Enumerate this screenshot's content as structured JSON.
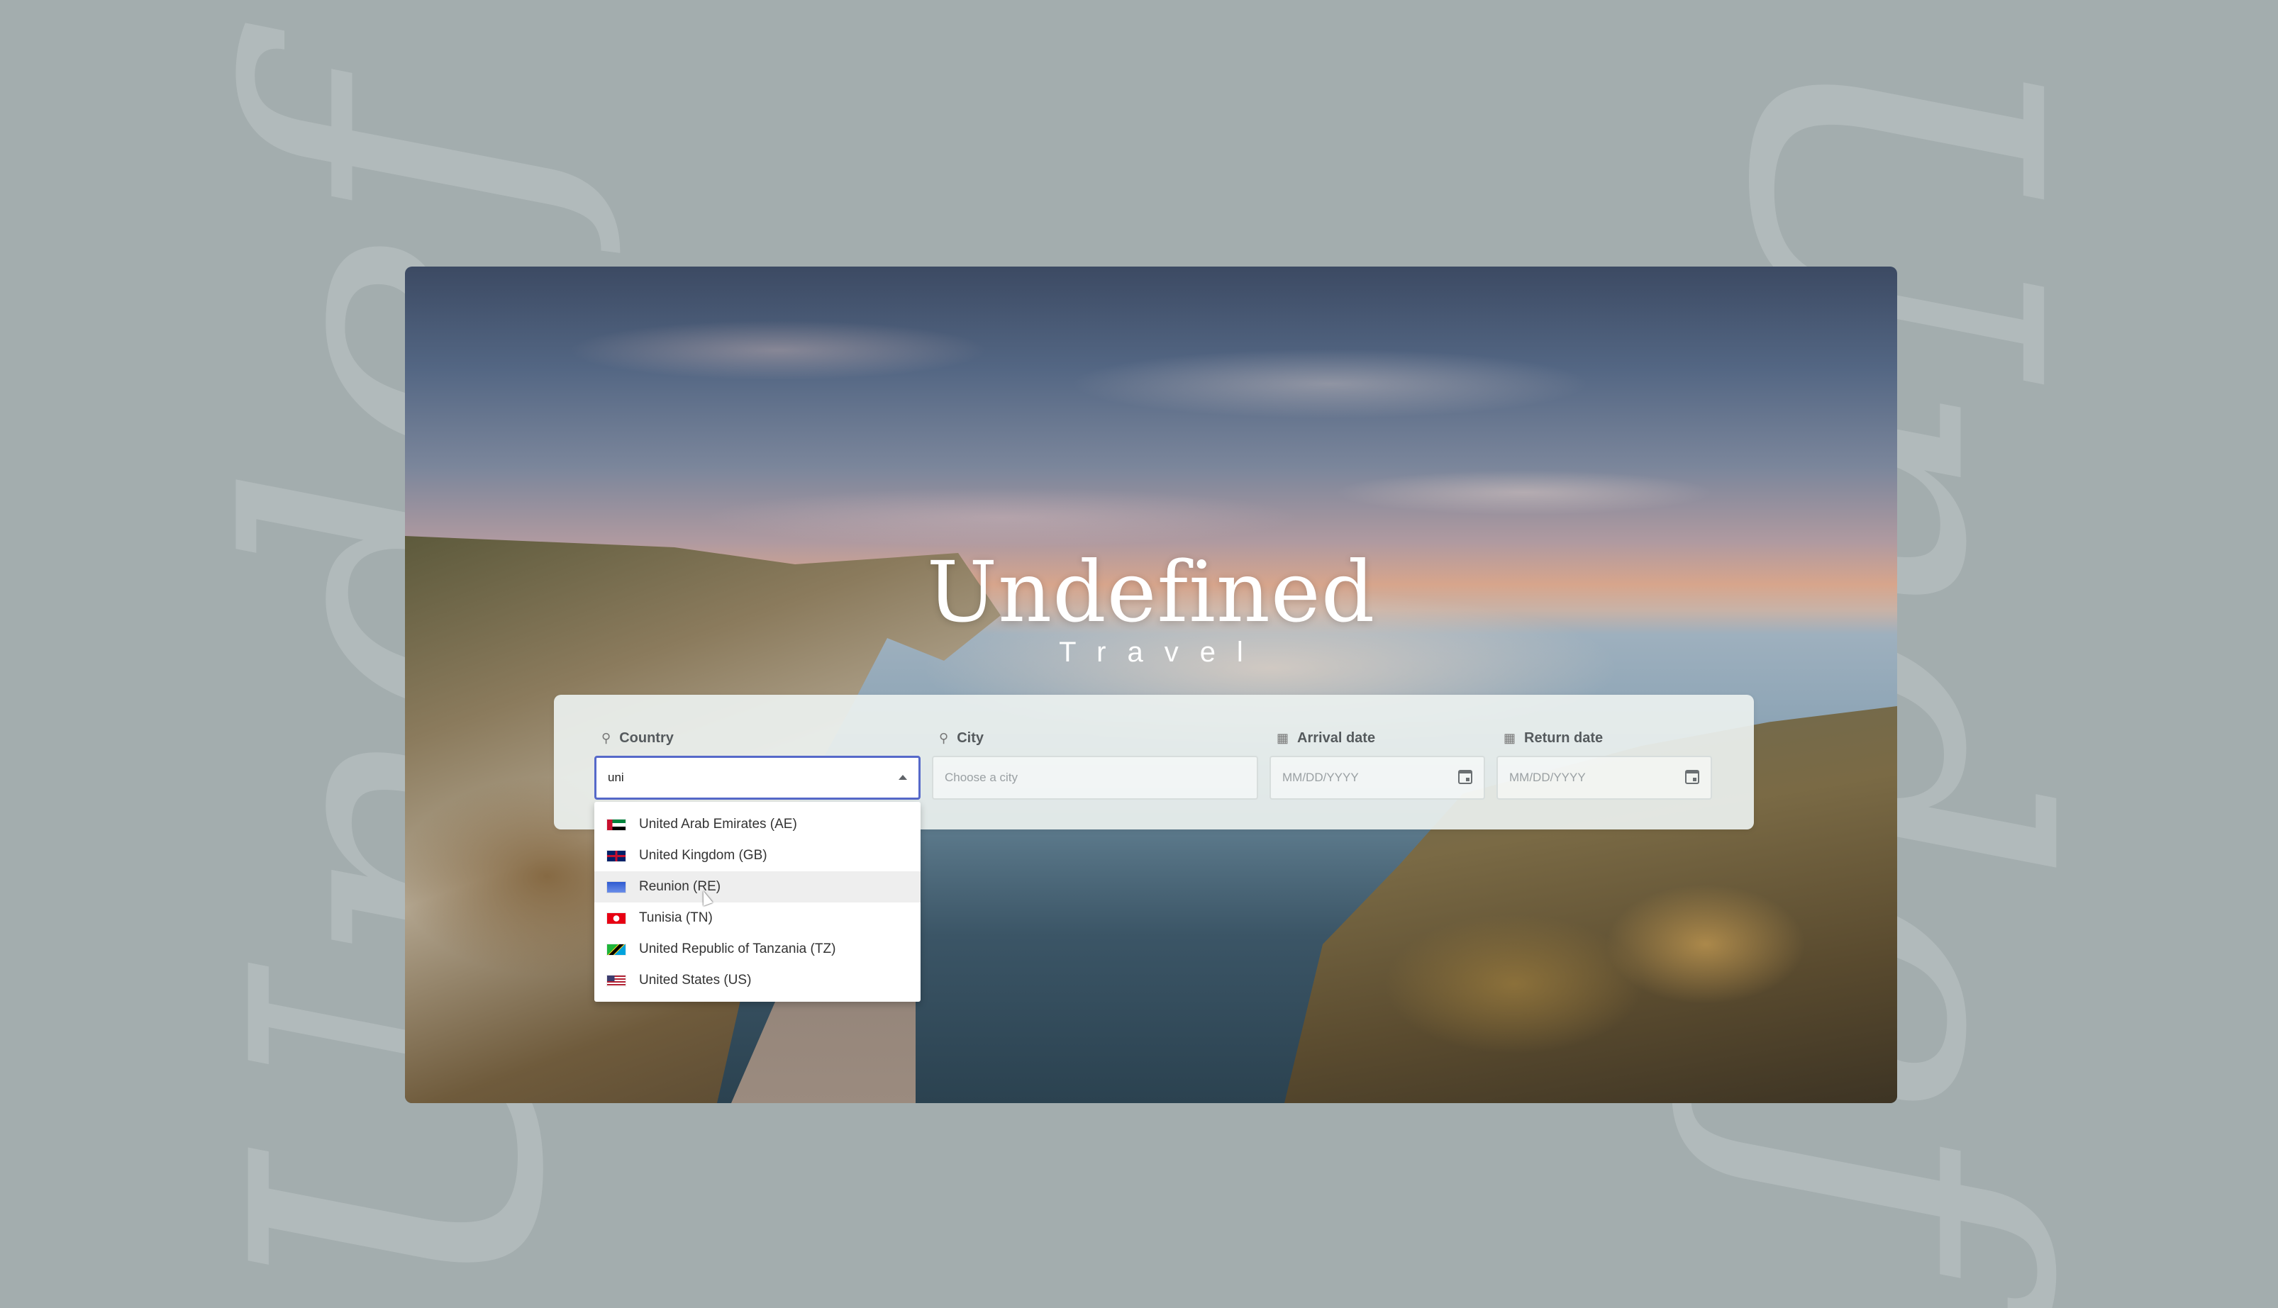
{
  "brand": {
    "title": "Undefined",
    "subtitle": "Travel"
  },
  "search": {
    "country": {
      "label": "Country",
      "icon": "map-pin-icon",
      "value": "uni"
    },
    "city": {
      "label": "City",
      "icon": "map-pin-icon",
      "placeholder": "Choose a city"
    },
    "arrival": {
      "label": "Arrival date",
      "icon": "calendar-icon",
      "placeholder": "MM/DD/YYYY"
    },
    "return": {
      "label": "Return date",
      "icon": "calendar-icon",
      "placeholder": "MM/DD/YYYY"
    }
  },
  "dropdown": {
    "options": [
      {
        "label": "United Arab Emirates (AE)",
        "flag": "ae"
      },
      {
        "label": "United Kingdom (GB)",
        "flag": "gb"
      },
      {
        "label": "Reunion (RE)",
        "flag": "re",
        "hovered": true
      },
      {
        "label": "Tunisia (TN)",
        "flag": "tn"
      },
      {
        "label": "United Republic of Tanzania (TZ)",
        "flag": "tz"
      },
      {
        "label": "United States (US)",
        "flag": "us"
      }
    ]
  },
  "colors": {
    "background": "#a3adae",
    "focus_border": "#5669c9",
    "panel": "#ecf1ef"
  }
}
